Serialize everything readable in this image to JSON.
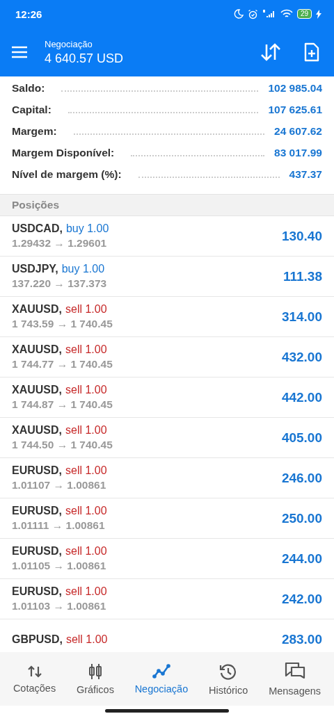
{
  "status_bar": {
    "time": "12:26",
    "battery": "29"
  },
  "header": {
    "title": "Negociação",
    "balance": "4 640.57 USD"
  },
  "summary": [
    {
      "label": "Saldo:",
      "value": "102 985.04"
    },
    {
      "label": "Capital:",
      "value": "107 625.61"
    },
    {
      "label": "Margem:",
      "value": "24 607.62"
    },
    {
      "label": "Margem Disponível:",
      "value": "83 017.99"
    },
    {
      "label": "Nível de margem (%):",
      "value": "437.37"
    }
  ],
  "positions": {
    "title": "Posições",
    "rows": [
      {
        "symbol": "USDCAD,",
        "kind": "buy",
        "trade": "buy 1.00",
        "prices": "1.29432 → 1.29601",
        "profit": "130.40"
      },
      {
        "symbol": "USDJPY,",
        "kind": "buy",
        "trade": "buy 1.00",
        "prices": "137.220 → 137.373",
        "profit": "111.38"
      },
      {
        "symbol": "XAUUSD,",
        "kind": "sell",
        "trade": "sell 1.00",
        "prices": "1 743.59 → 1 740.45",
        "profit": "314.00"
      },
      {
        "symbol": "XAUUSD,",
        "kind": "sell",
        "trade": "sell 1.00",
        "prices": "1 744.77 → 1 740.45",
        "profit": "432.00"
      },
      {
        "symbol": "XAUUSD,",
        "kind": "sell",
        "trade": "sell 1.00",
        "prices": "1 744.87 → 1 740.45",
        "profit": "442.00"
      },
      {
        "symbol": "XAUUSD,",
        "kind": "sell",
        "trade": "sell 1.00",
        "prices": "1 744.50 → 1 740.45",
        "profit": "405.00"
      },
      {
        "symbol": "EURUSD,",
        "kind": "sell",
        "trade": "sell 1.00",
        "prices": "1.01107 → 1.00861",
        "profit": "246.00"
      },
      {
        "symbol": "EURUSD,",
        "kind": "sell",
        "trade": "sell 1.00",
        "prices": "1.01111 → 1.00861",
        "profit": "250.00"
      },
      {
        "symbol": "EURUSD,",
        "kind": "sell",
        "trade": "sell 1.00",
        "prices": "1.01105 → 1.00861",
        "profit": "244.00"
      },
      {
        "symbol": "EURUSD,",
        "kind": "sell",
        "trade": "sell 1.00",
        "prices": "1.01103 → 1.00861",
        "profit": "242.00"
      },
      {
        "symbol": "GBPUSD,",
        "kind": "sell",
        "trade": "sell 1.00",
        "profit": "283.00"
      }
    ]
  },
  "bottom_nav": [
    {
      "label": "Cotações",
      "selected": false
    },
    {
      "label": "Gráficos",
      "selected": false
    },
    {
      "label": "Negociação",
      "selected": true
    },
    {
      "label": "Histórico",
      "selected": false
    },
    {
      "label": "Mensagens",
      "selected": false
    }
  ]
}
